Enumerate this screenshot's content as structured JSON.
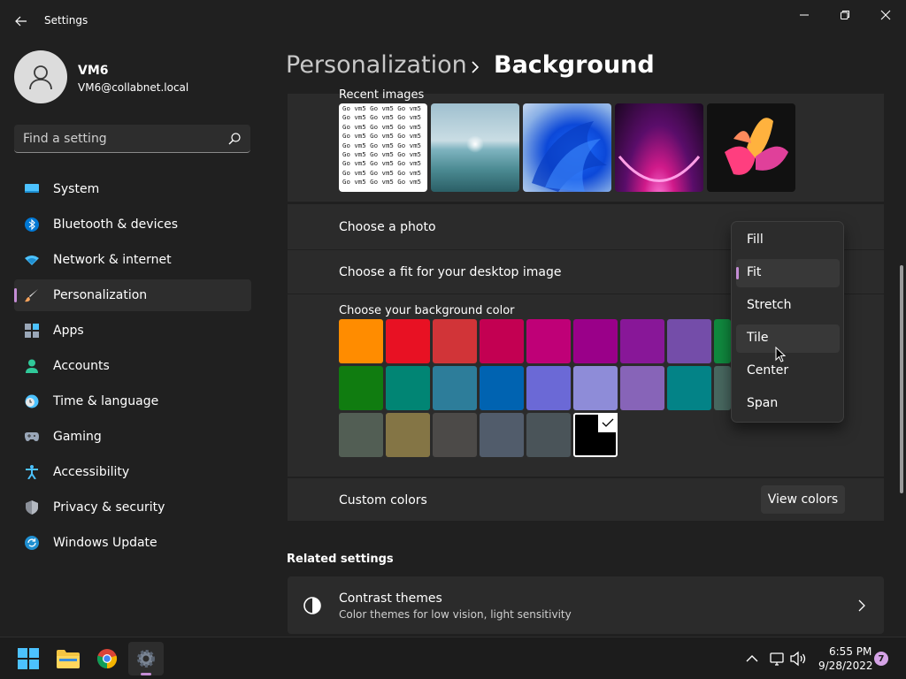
{
  "window": {
    "title": "Settings"
  },
  "profile": {
    "name": "VM6",
    "email": "VM6@collabnet.local"
  },
  "search": {
    "placeholder": "Find a setting"
  },
  "nav": [
    {
      "label": "System",
      "icon": "system-icon"
    },
    {
      "label": "Bluetooth & devices",
      "icon": "bluetooth-icon"
    },
    {
      "label": "Network & internet",
      "icon": "network-icon"
    },
    {
      "label": "Personalization",
      "icon": "brush-icon",
      "selected": true
    },
    {
      "label": "Apps",
      "icon": "apps-icon"
    },
    {
      "label": "Accounts",
      "icon": "accounts-icon"
    },
    {
      "label": "Time & language",
      "icon": "time-language-icon"
    },
    {
      "label": "Gaming",
      "icon": "gaming-icon"
    },
    {
      "label": "Accessibility",
      "icon": "accessibility-icon"
    },
    {
      "label": "Privacy & security",
      "icon": "shield-icon"
    },
    {
      "label": "Windows Update",
      "icon": "update-icon"
    }
  ],
  "breadcrumb": {
    "parent": "Personalization",
    "current": "Background"
  },
  "background": {
    "recent_images_label": "Recent images",
    "thumb_pattern_text": "Go vm5 Go vm5 Go vm5",
    "choose_photo_label": "Choose a photo",
    "choose_fit_label": "Choose a fit for your desktop image",
    "choose_color_label": "Choose your background color",
    "custom_colors_label": "Custom colors",
    "view_colors_label": "View colors",
    "color_swatches": [
      [
        "#ff8c00",
        "#e81123",
        "#d13438",
        "#c30052",
        "#bf0077",
        "#9a0089",
        "#881798",
        "#744da9",
        "#10893e"
      ],
      [
        "#107c10",
        "#018574",
        "#2d7d9a",
        "#0063b1",
        "#6b69d6",
        "#8e8cd8",
        "#8764b8",
        "#038387",
        "#486860"
      ],
      [
        "#525e54",
        "#847545",
        "#4c4a48",
        "#515c6b",
        "#4a5459",
        "#000000"
      ]
    ],
    "selected_color": "#000000"
  },
  "fit_dropdown": {
    "options": [
      "Fill",
      "Fit",
      "Stretch",
      "Tile",
      "Center",
      "Span"
    ],
    "selected": "Fit",
    "hovered": "Tile"
  },
  "related": {
    "header": "Related settings",
    "contrast_title": "Contrast themes",
    "contrast_desc": "Color themes for low vision, light sensitivity"
  },
  "taskbar": {
    "time": "6:55 PM",
    "date": "9/28/2022",
    "notification_count": "7"
  },
  "colors": {
    "accent": "#c48dd5",
    "background": "#202020",
    "card": "#2b2b2b"
  }
}
